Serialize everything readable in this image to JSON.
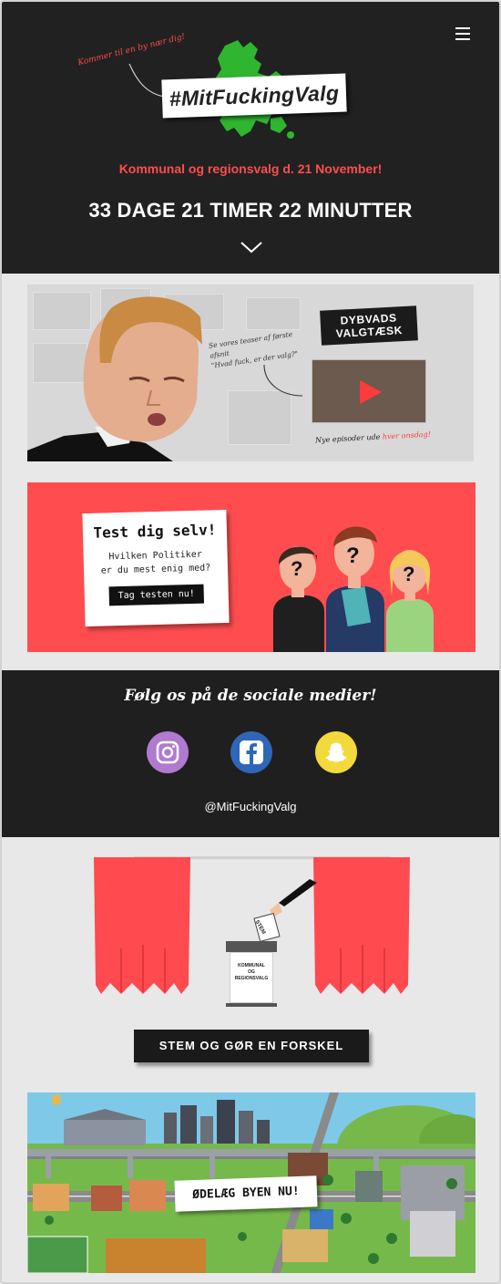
{
  "header": {
    "menu_icon": "hamburger-icon",
    "tagline": "Kommer til en by nær dig!",
    "logo": "#MitFuckingValg",
    "election_text": "Kommunal og regionsvalg d. 21 November!",
    "countdown": "33 DAGE 21 TIMER 22 MINUTTER",
    "scroll_icon": "chevron-down-icon",
    "colors": {
      "bg": "#212121",
      "accent": "#ff4d4d",
      "map": "#2fb52f"
    }
  },
  "promo": {
    "title_line1": "DYBVADS",
    "title_line2": "VALGTÆSK",
    "quote_line1": "Se vores teaser af første afsnit",
    "quote_line2": "\"Hvad fuck, er der valg?\"",
    "footer_prefix": "Nye episoder ude ",
    "footer_highlight": "hver onsdag!"
  },
  "quiz": {
    "title": "Test dig selv!",
    "question_line1": "Hvilken Politiker",
    "question_line2": "er du mest enig med?",
    "button": "Tag testen nu!",
    "bg": "#ff4d4f"
  },
  "social": {
    "title": "Følg os på de sociale medier!",
    "icons": [
      "instagram-icon",
      "facebook-icon",
      "snapchat-icon"
    ],
    "handle": "@MitFuckingValg"
  },
  "vote": {
    "ballot_label": "STEM",
    "box_line1": "KOMMUNAL",
    "box_line2": "OG",
    "box_line3": "REGIONSVALG",
    "button": "STEM OG GØR EN FORSKEL",
    "curtain_color": "#ff4a50"
  },
  "city": {
    "button": "ØDELÆG BYEN NU!"
  }
}
